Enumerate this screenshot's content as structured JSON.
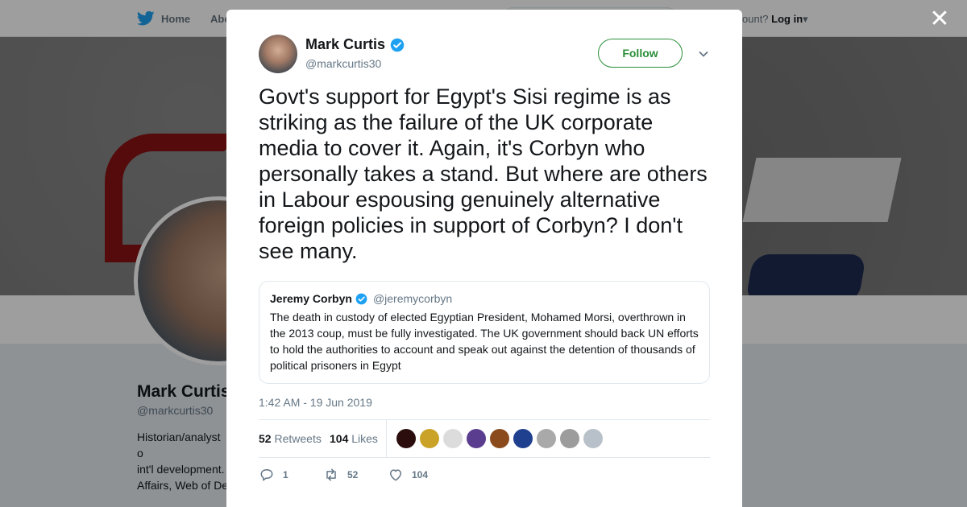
{
  "nav": {
    "home_label": "Home",
    "about_label": "Abo",
    "login_prefix": "ccount?",
    "login_label": "Log in"
  },
  "profile": {
    "name": "Mark Curtis",
    "handle": "@markcurtis30",
    "bio": "Historian/analyst o\nint'l development.\nAffairs, Web of De\nDeception. Colum"
  },
  "tweet": {
    "author_name": "Mark Curtis",
    "author_handle": "@markcurtis30",
    "follow_label": "Follow",
    "text": "Govt's support for Egypt's Sisi regime is as striking as the failure of the UK corporate media to cover it. Again, it's Corbyn who personally takes a stand. But where are others in Labour espousing genuinely alternative foreign policies in support of Corbyn? I don't see many.",
    "quoted": {
      "name": "Jeremy Corbyn",
      "handle": "@jeremycorbyn",
      "text": "The death in custody of elected Egyptian President, Mohamed Morsi, overthrown in the 2013 coup, must be fully investigated. The UK government should back UN efforts to hold the authorities to account and speak out against the detention of thousands of political prisoners in Egypt"
    },
    "timestamp": "1:42 AM - 19 Jun 2019",
    "retweets_count": "52",
    "retweets_label": "Retweets",
    "likes_count": "104",
    "likes_label": "Likes",
    "actions": {
      "reply_count": "1",
      "retweet_count": "52",
      "like_count": "104"
    }
  },
  "colors": {
    "verified": "#1da1f2",
    "follow": "#2a8e38",
    "secondary_text": "#657786"
  },
  "likers": [
    "#2b0d0d",
    "#c9a227",
    "#dcdcdc",
    "#5b3d8f",
    "#8a4a1c",
    "#1f3f8f",
    "#a9a9a9",
    "#9c9c9c",
    "#b8c1ca"
  ]
}
